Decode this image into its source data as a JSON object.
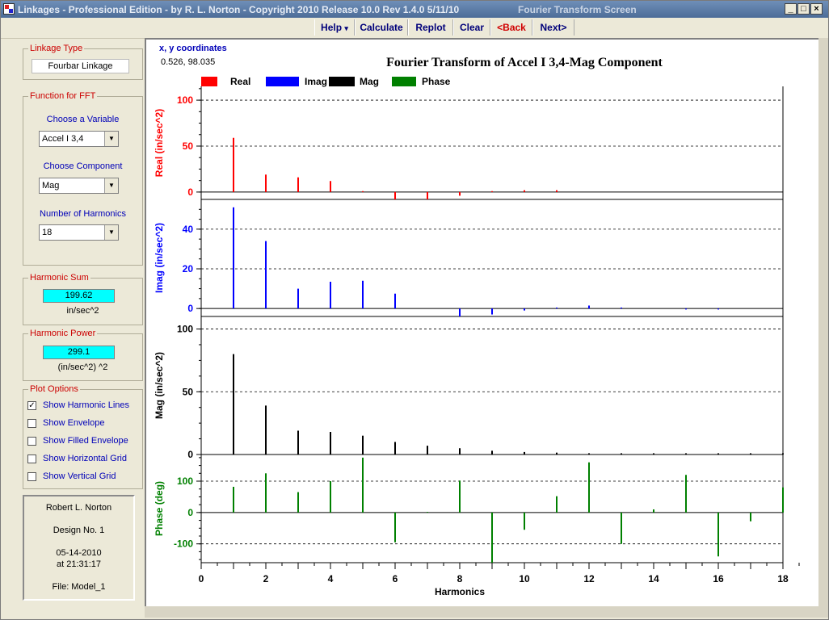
{
  "window": {
    "title": "Linkages - Professional Edition - by R. L. Norton - Copyright 2010   Release 10.0   Rev 1.4.0   5/11/10",
    "screen_name": "Fourier Transform Screen",
    "minimize": "_",
    "maximize": "□",
    "close": "×"
  },
  "menu": {
    "help": "Help",
    "help_arrow": "▾",
    "calculate": "Calculate",
    "replot": "Replot",
    "clear": "Clear",
    "back": "<Back",
    "next": "Next>"
  },
  "left": {
    "linkage_type": {
      "label": "Linkage Type",
      "value": "Fourbar Linkage"
    },
    "fft": {
      "label": "Function for FFT",
      "variable_label": "Choose a Variable",
      "variable_value": "Accel I 3,4",
      "component_label": "Choose Component",
      "component_value": "Mag",
      "harmonics_label": "Number of Harmonics",
      "harmonics_value": "18"
    },
    "harmonic_sum": {
      "label": "Harmonic Sum",
      "value": "199.62",
      "units": "in/sec^2"
    },
    "harmonic_power": {
      "label": "Harmonic Power",
      "value": "299.1",
      "units": "(in/sec^2) ^2"
    },
    "plot_options": {
      "label": "Plot Options",
      "items": [
        {
          "label": "Show Harmonic Lines",
          "checked": true
        },
        {
          "label": "Show Envelope",
          "checked": false
        },
        {
          "label": "Show Filled Envelope",
          "checked": false
        },
        {
          "label": "Show Horizontal Grid",
          "checked": false
        },
        {
          "label": "Show Vertical Grid",
          "checked": false
        }
      ]
    },
    "info": {
      "author": "Robert L. Norton",
      "design": "Design No. 1",
      "date": "05-14-2010",
      "time": "at 21:31:17",
      "file": "File: Model_1"
    }
  },
  "plot": {
    "coord_label": "x, y  coordinates",
    "coord_value": "0.526, 98.035"
  },
  "chart_data": {
    "type": "bar",
    "title": "Fourier Transform of Accel I 3,4-Mag Component",
    "xlabel": "Harmonics",
    "xlim": [
      0,
      18
    ],
    "xticks": [
      0,
      2,
      4,
      6,
      8,
      10,
      12,
      14,
      16,
      18
    ],
    "legend": {
      "placement": "top-left",
      "entries": [
        {
          "name": "Real",
          "color": "#ff0000"
        },
        {
          "name": "Imag",
          "color": "#0000ff"
        },
        {
          "name": "Mag",
          "color": "#000000"
        },
        {
          "name": "Phase",
          "color": "#008000"
        }
      ]
    },
    "panels": [
      {
        "name": "Real",
        "ylabel": "Real  (in/sec^2)",
        "color": "#ff0000",
        "ylim": [
          -8,
          115
        ],
        "ticks": [
          0,
          50,
          100
        ],
        "harmonics": [
          1,
          2,
          3,
          4,
          5,
          6,
          7,
          8,
          9,
          10,
          11
        ],
        "values": [
          59,
          19,
          16,
          12,
          1,
          -8,
          -8,
          -4,
          1,
          2,
          2
        ]
      },
      {
        "name": "Imag",
        "ylabel": "Imag  (in/sec^2)",
        "color": "#0000ff",
        "ylim": [
          -4,
          55
        ],
        "ticks": [
          0,
          20,
          40
        ],
        "harmonics": [
          1,
          2,
          3,
          4,
          5,
          6,
          8,
          9,
          10,
          11,
          12,
          13,
          15,
          16
        ],
        "values": [
          51,
          34,
          10,
          13.5,
          14,
          7.5,
          -4,
          -3,
          -1,
          0.5,
          1.5,
          0.5,
          -0.5,
          -0.5
        ]
      },
      {
        "name": "Mag",
        "ylabel": "Mag  (in/sec^2)",
        "color": "#000000",
        "ylim": [
          0,
          110
        ],
        "ticks": [
          0,
          50,
          100
        ],
        "harmonics": [
          1,
          2,
          3,
          4,
          5,
          6,
          7,
          8,
          9,
          10,
          11,
          12,
          13,
          14,
          15,
          16,
          17,
          18
        ],
        "values": [
          80,
          39,
          19,
          18,
          15,
          10,
          7,
          5,
          3,
          2,
          1.5,
          1,
          1,
          1,
          1,
          1,
          1,
          1
        ]
      },
      {
        "name": "Phase",
        "ylabel": "Phase  (deg)",
        "color": "#008000",
        "ylim": [
          -160,
          185
        ],
        "ticks": [
          -100,
          0,
          100
        ],
        "harmonics": [
          1,
          2,
          3,
          4,
          5,
          6,
          7,
          8,
          9,
          10,
          11,
          12,
          13,
          14,
          15,
          16,
          17,
          18
        ],
        "values": [
          82,
          125,
          65,
          100,
          175,
          -95,
          2,
          102,
          -160,
          -55,
          52,
          160,
          -100,
          10,
          120,
          -140,
          -28,
          80
        ]
      }
    ]
  }
}
